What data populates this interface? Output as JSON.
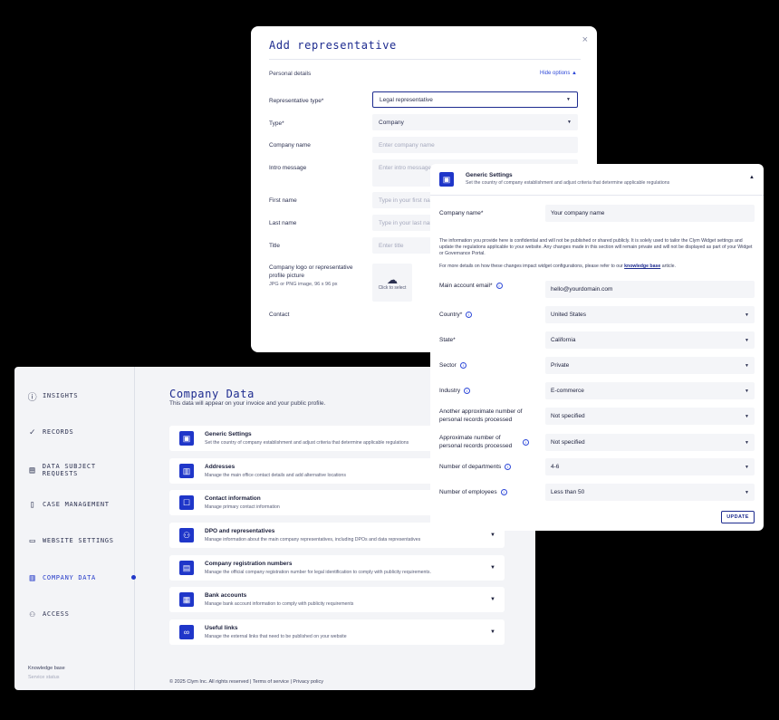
{
  "rep": {
    "title": "Add representative",
    "close_icon": "×",
    "section": "Personal details",
    "hide_options": "Hide options",
    "fields": {
      "rep_type": {
        "label": "Representative type*",
        "value": "Legal representative"
      },
      "type": {
        "label": "Type*",
        "value": "Company"
      },
      "company_name": {
        "label": "Company name",
        "placeholder": "Enter company name"
      },
      "intro": {
        "label": "Intro message",
        "placeholder": "Enter intro message"
      },
      "first_name": {
        "label": "First name",
        "placeholder": "Type in your first name"
      },
      "last_name": {
        "label": "Last name",
        "placeholder": "Type in your last name"
      },
      "title": {
        "label": "Title",
        "placeholder": "Enter title"
      },
      "logo": {
        "label": "Company logo or representative profile picture",
        "hint": "JPG or PNG image, 96 x 96 px",
        "upload": "Click to select"
      },
      "contact": {
        "label": "Contact"
      }
    }
  },
  "main": {
    "title": "Company Data",
    "subtitle": "This data will appear on your invoice and your public profile.",
    "nav": [
      {
        "label": "INSIGHTS",
        "icon": "info-icon"
      },
      {
        "label": "RECORDS",
        "icon": "check-circle-icon"
      },
      {
        "label": "DATA SUBJECT REQUESTS",
        "icon": "file-icon"
      },
      {
        "label": "CASE MANAGEMENT",
        "icon": "folder-icon"
      },
      {
        "label": "WEBSITE SETTINGS",
        "icon": "browser-icon"
      },
      {
        "label": "COMPANY DATA",
        "icon": "building-icon",
        "active": true
      },
      {
        "label": "ACCESS",
        "icon": "users-icon"
      }
    ],
    "side_footer": [
      "Knowledge base",
      "Service status"
    ],
    "cards": [
      {
        "title": "Generic Settings",
        "desc": "Set the country of company establishment and adjust criteria that determine applicable regulations",
        "icon": "clipboard-icon"
      },
      {
        "title": "Addresses",
        "desc": "Manage the main office contact details and add alternative locations",
        "icon": "building-icon"
      },
      {
        "title": "Contact information",
        "desc": "Manage primary contact information",
        "icon": "contact-icon"
      },
      {
        "title": "DPO and representatives",
        "desc": "Manage information about the main company representatives, including DPOs and data representatives",
        "icon": "people-icon"
      },
      {
        "title": "Company registration numbers",
        "desc": "Manage the official company registration number for legal identification to comply with publicity requirements.",
        "icon": "id-card-icon"
      },
      {
        "title": "Bank accounts",
        "desc": "Manage bank account information to comply with publicity requirements",
        "icon": "bank-icon"
      },
      {
        "title": "Useful links",
        "desc": "Manage the external links that need to be published on your website",
        "icon": "link-icon"
      }
    ],
    "footer": "© 2025 Clym Inc. All rights reserved  |  Terms of service  |  Privacy policy"
  },
  "generic": {
    "title": "Generic Settings",
    "desc": "Set the country of company establishment and adjust criteria that determine applicable regulations",
    "company_name": {
      "label": "Company name*",
      "value": "Your company name"
    },
    "note1": "The information you provide here is confidential and will not be published or shared publicly. It is solely used to tailor the Clym Widget settings and update the regulations applicable to your website. Any changes made in this section will remain private and will not be displayed as part of your Widget or Governance Portal.",
    "note2_prefix": "For more details on how these changes impact widget configurations, please refer to our",
    "note2_link": "knowledge base",
    "note2_suffix": "article.",
    "fields": [
      {
        "label": "Main account email*",
        "value": "hello@yourdomain.com",
        "info": true,
        "dropdown": false
      },
      {
        "label": "Country*",
        "value": "United States",
        "info": true,
        "dropdown": true
      },
      {
        "label": "State*",
        "value": "California",
        "info": false,
        "dropdown": true
      },
      {
        "label": "Sector",
        "value": "Private",
        "info": true,
        "dropdown": true
      },
      {
        "label": "Industry",
        "value": "E-commerce",
        "info": true,
        "dropdown": true
      },
      {
        "label": "Another approximate number of personal records processed",
        "value": "Not specified",
        "info": false,
        "dropdown": true
      },
      {
        "label": "Approximate number of personal records processed",
        "value": "Not specified",
        "info": true,
        "dropdown": true
      },
      {
        "label": "Number of departments",
        "value": "4-6",
        "info": true,
        "dropdown": true
      },
      {
        "label": "Number of employees",
        "value": "Less than 50",
        "info": true,
        "dropdown": true
      }
    ],
    "update": "UPDATE"
  }
}
